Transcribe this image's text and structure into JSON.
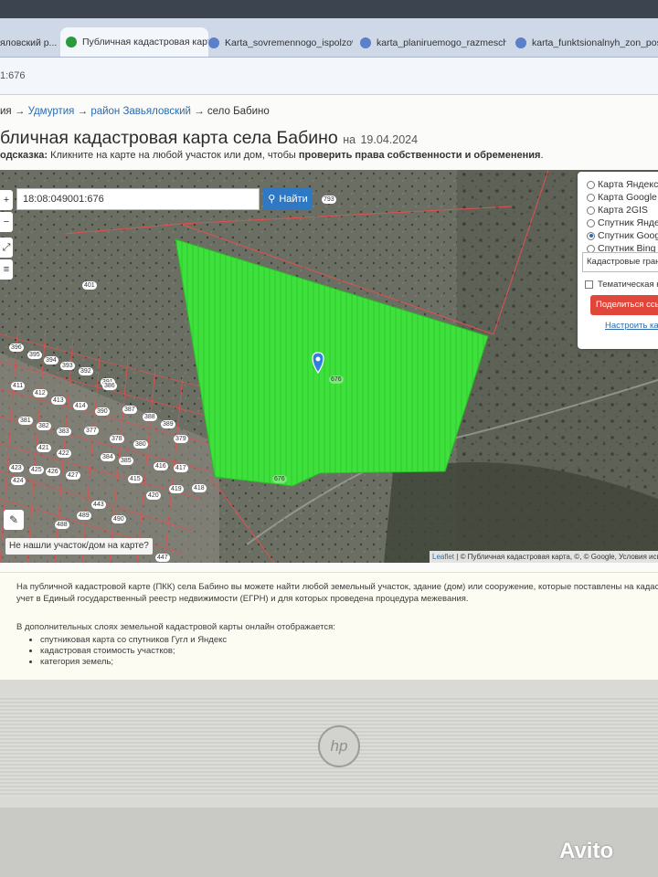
{
  "browser": {
    "tabs": [
      {
        "label": "яловский р..."
      },
      {
        "label": "Публичная кадастровая карт"
      },
      {
        "label": "Karta_sovremennogo_ispolzov"
      },
      {
        "label": "karta_planiruemogo_razmesch"
      },
      {
        "label": "karta_funktsionalnyh_zon_pos"
      }
    ],
    "address": "1:676"
  },
  "breadcrumb": {
    "first": "ия",
    "sep": "→",
    "udmurtia": "Удмуртия",
    "district": "район Завьяловский",
    "current": "село Бабино"
  },
  "page": {
    "title": "бличная кадастровая карта села Бабино",
    "date_prefix": "на",
    "date": "19.04.2024",
    "hint_label": "одсказка:",
    "hint_text": "Кликните на карте на любой участок или дом, чтобы",
    "hint_bold": "проверить права собственности и обременения",
    "hint_end": "."
  },
  "map": {
    "search_value": "18:08:049001:676",
    "search_button": "Найти",
    "zoom_in": "+",
    "zoom_out": "−",
    "layers": [
      {
        "label": "Карта Яндекс",
        "selected": false
      },
      {
        "label": "Карта Google",
        "selected": false
      },
      {
        "label": "Карта 2GIS",
        "selected": false
      },
      {
        "label": "Спутник Яндекс",
        "selected": false
      },
      {
        "label": "Спутник Google",
        "selected": true
      },
      {
        "label": "Спутник Bing",
        "selected": false
      }
    ],
    "layer_select": "Кадастровые границы",
    "thematic_label": "Тематическая карта",
    "share_button": "Поделиться ссылкой",
    "setup_link": "Настроить карту",
    "not_found": "Не нашли участок/дом на карте?",
    "attribution_leaflet": "Leaflet",
    "attribution_rest": "| © Публичная кадастровая карта, ©, © Google, Условия исполь",
    "plot_labels": [
      "793",
      "401",
      "676",
      "676",
      "377",
      "379",
      "415",
      "416",
      "417",
      "418",
      "419",
      "420",
      "423",
      "424",
      "425",
      "426",
      "427",
      "443",
      "447",
      "489",
      "396",
      "395",
      "394",
      "393",
      "392",
      "391",
      "411",
      "412",
      "413",
      "414",
      "421",
      "422",
      "488",
      "490",
      "386",
      "387",
      "388",
      "389",
      "390",
      "378",
      "380",
      "381",
      "382",
      "383",
      "384",
      "385"
    ],
    "highlight_color": "#3ee03c"
  },
  "info": {
    "p1": "На публичной кадастровой карте (ПКК) села Бабино вы можете найти любой земельный участок, здание (дом) или сооружение, которые поставлены на кадастровый",
    "p2": "учет в Единый государственный реестр недвижимости (ЕГРН) и для которых проведена процедура межевания.",
    "p3": "В дополнительных слоях земельной кадастровой карты онлайн отображается:",
    "items": [
      "спутниковая карта со спутников Гугл и Яндекс",
      "кадастровая стоимость участков;",
      "категория земель;"
    ]
  },
  "device": {
    "logo": "hp",
    "watermark": "Avito"
  }
}
